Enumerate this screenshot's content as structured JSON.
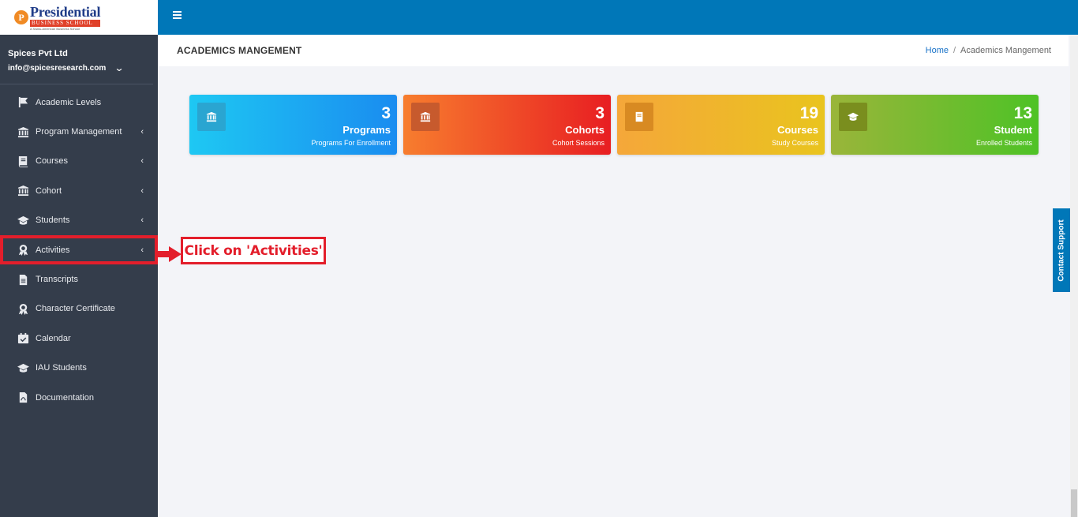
{
  "brand": {
    "logo_letter": "P",
    "logo_main": "Presidential",
    "logo_sub": "BUSINESS SCHOOL",
    "logo_tag": "A Swiss-American Business School"
  },
  "user": {
    "company": "Spices Pvt Ltd",
    "email": "info@spicesresearch.com"
  },
  "sidebar": {
    "items": [
      {
        "label": "Academic Levels",
        "icon": "flag-icon",
        "arrow": false
      },
      {
        "label": "Program Management",
        "icon": "bank-icon",
        "arrow": true
      },
      {
        "label": "Courses",
        "icon": "book-icon",
        "arrow": true
      },
      {
        "label": "Cohort",
        "icon": "bank-icon",
        "arrow": true
      },
      {
        "label": "Students",
        "icon": "graduation-cap-icon",
        "arrow": true
      },
      {
        "label": "Activities",
        "icon": "award-icon",
        "arrow": true
      },
      {
        "label": "Transcripts",
        "icon": "file-icon",
        "arrow": false
      },
      {
        "label": "Character Certificate",
        "icon": "award-icon",
        "arrow": false
      },
      {
        "label": "Calendar",
        "icon": "calendar-check-icon",
        "arrow": false
      },
      {
        "label": "IAU Students",
        "icon": "graduation-cap-icon",
        "arrow": false
      },
      {
        "label": "Documentation",
        "icon": "pdf-file-icon",
        "arrow": false
      }
    ],
    "arrow_glyph": "‹"
  },
  "header": {
    "title": "ACADEMICS MANGEMENT",
    "breadcrumb": {
      "home": "Home",
      "sep": "/",
      "current": "Academics Mangement"
    }
  },
  "cards": [
    {
      "value": "3",
      "title": "Programs",
      "subtitle": "Programs For Enrollment",
      "icon": "bank-icon"
    },
    {
      "value": "3",
      "title": "Cohorts",
      "subtitle": "Cohort Sessions",
      "icon": "bank-icon"
    },
    {
      "value": "19",
      "title": "Courses",
      "subtitle": "Study Courses",
      "icon": "book-icon"
    },
    {
      "value": "13",
      "title": "Student",
      "subtitle": "Enrolled Students",
      "icon": "graduation-cap-icon"
    }
  ],
  "callout": {
    "text": "Click on 'Activities'"
  },
  "contact_support": "Contact Support",
  "colors": {
    "topbar": "#0077b8",
    "sidebar": "#343d4b",
    "highlight": "#e31e2b"
  }
}
